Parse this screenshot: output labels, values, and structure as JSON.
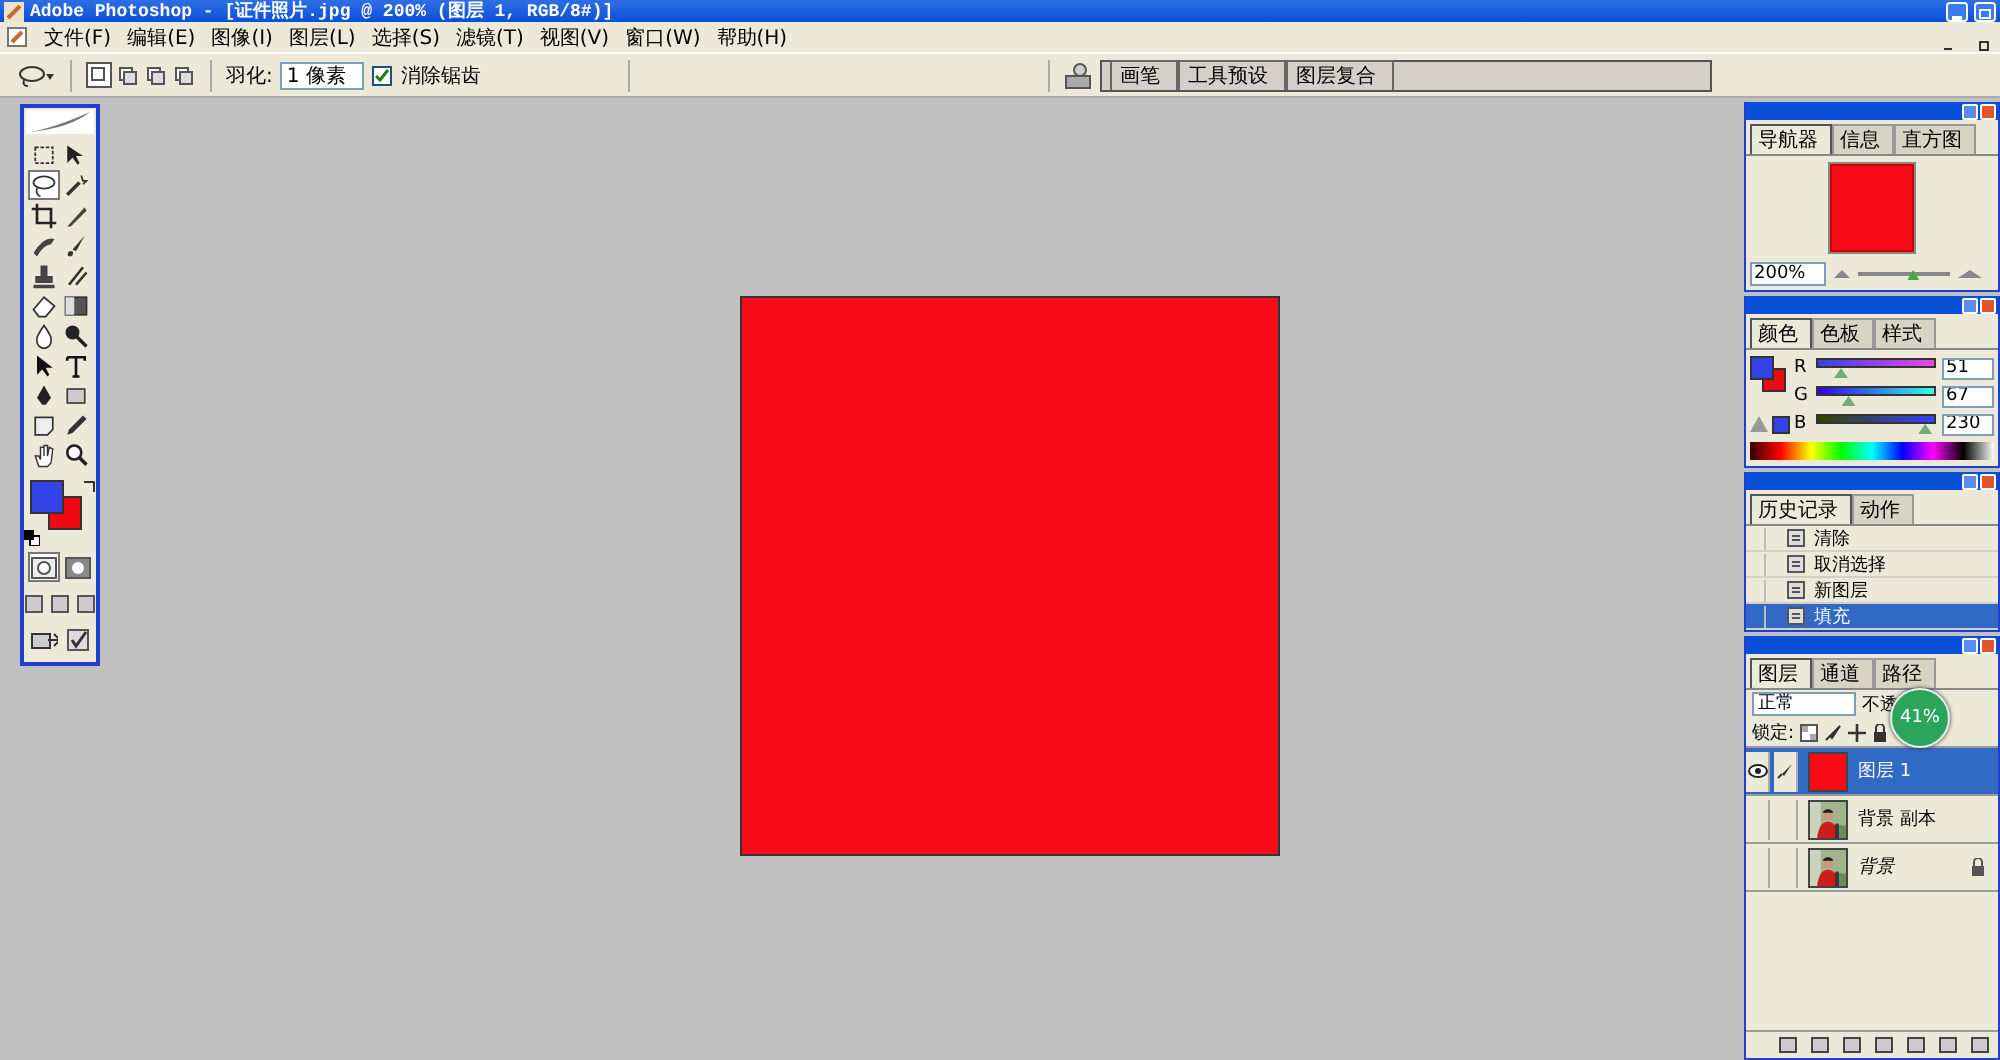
{
  "window": {
    "title": "Adobe Photoshop - [证件照片.jpg @ 200% (图层 1, RGB/8#)]"
  },
  "menu": [
    "文件(F)",
    "编辑(E)",
    "图像(I)",
    "图层(L)",
    "选择(S)",
    "滤镜(T)",
    "视图(V)",
    "窗口(W)",
    "帮助(H)"
  ],
  "options_bar": {
    "feather_label": "羽化:",
    "feather_value": "1 像素",
    "antialias": {
      "label": "消除锯齿",
      "checked": true
    }
  },
  "palette_well": [
    "画笔",
    "工具预设",
    "图层复合"
  ],
  "toolbox": {
    "tools": [
      {
        "kind": "marquee",
        "selected": false
      },
      {
        "kind": "move",
        "selected": false
      },
      {
        "kind": "lasso",
        "selected": true
      },
      {
        "kind": "wand",
        "selected": false
      },
      {
        "kind": "crop",
        "selected": false
      },
      {
        "kind": "slice",
        "selected": false
      },
      {
        "kind": "heal",
        "selected": false
      },
      {
        "kind": "brush",
        "selected": false
      },
      {
        "kind": "stamp",
        "selected": false
      },
      {
        "kind": "history",
        "selected": false
      },
      {
        "kind": "eraser",
        "selected": false
      },
      {
        "kind": "gradient",
        "selected": false
      },
      {
        "kind": "blur",
        "selected": false
      },
      {
        "kind": "dodge",
        "selected": false
      },
      {
        "kind": "select",
        "selected": false
      },
      {
        "kind": "text",
        "selected": false
      },
      {
        "kind": "pen",
        "selected": false
      },
      {
        "kind": "shape",
        "selected": false
      },
      {
        "kind": "notes",
        "selected": false
      },
      {
        "kind": "eyedropper",
        "selected": false
      },
      {
        "kind": "hand",
        "selected": false
      },
      {
        "kind": "zoom",
        "selected": false
      }
    ],
    "swap": true
  },
  "navigator": {
    "tabs": [
      {
        "label": "导航器",
        "selected": true
      },
      {
        "label": "信息",
        "selected": false
      },
      {
        "label": "直方图",
        "selected": false
      }
    ],
    "zoom": "200%",
    "level": 0.6
  },
  "color_panel": {
    "tabs": [
      {
        "label": "颜色",
        "selected": true
      },
      {
        "label": "色板",
        "selected": false
      },
      {
        "label": "样式",
        "selected": false
      }
    ],
    "channels": [
      {
        "name": "R",
        "value": "51",
        "level": 0.2
      },
      {
        "name": "G",
        "value": "67",
        "level": 0.263
      },
      {
        "name": "B",
        "value": "230",
        "level": 0.902
      }
    ]
  },
  "history": {
    "tabs": [
      {
        "label": "历史记录",
        "selected": true
      },
      {
        "label": "动作",
        "selected": false
      }
    ],
    "items": [
      {
        "label": "清除",
        "selected": false
      },
      {
        "label": "取消选择",
        "selected": false
      },
      {
        "label": "新图层",
        "selected": false
      },
      {
        "label": "填充",
        "selected": true
      }
    ]
  },
  "layers": {
    "tabs": [
      {
        "label": "图层",
        "selected": true
      },
      {
        "label": "通道",
        "selected": false
      },
      {
        "label": "路径",
        "selected": false
      }
    ],
    "blend_mode": "正常",
    "opacity_label": "不透",
    "lock_label": "锁定:",
    "badge": "41%",
    "items": [
      {
        "name": "图层 1",
        "kind": "fill",
        "visible": true,
        "selected": true,
        "locked": false
      },
      {
        "name": "背景 副本",
        "kind": "picture",
        "visible": false,
        "selected": false,
        "locked": false
      },
      {
        "name": "背景",
        "kind": "background",
        "visible": false,
        "selected": false,
        "locked": true
      }
    ]
  }
}
